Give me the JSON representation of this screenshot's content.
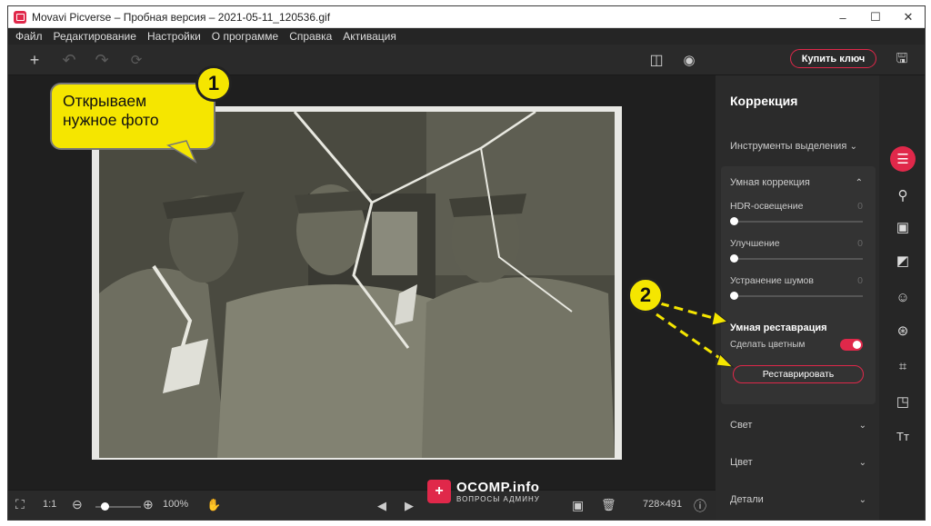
{
  "window": {
    "title": "Movavi Picverse – Пробная версия – 2021-05-11_120536.gif",
    "minimize": "–",
    "maximize": "☐",
    "close": "✕"
  },
  "menu": [
    "Файл",
    "Редактирование",
    "Настройки",
    "О программе",
    "Справка",
    "Активация"
  ],
  "toolbar": {
    "add": "+",
    "undo": "↶",
    "redo": "↷",
    "reset": "⟳",
    "compare": "◫",
    "preview": "◉",
    "buy_label": "Купить ключ",
    "save": "🖫"
  },
  "sidebar": {
    "title": "Коррекция",
    "selection_tools": "Инструменты выделения",
    "smart_correction": {
      "title": "Умная коррекция",
      "sliders": [
        {
          "label": "HDR-освещение",
          "value": "0",
          "level": 0
        },
        {
          "label": "Улучшение",
          "value": "0",
          "level": 0
        },
        {
          "label": "Устранение шумов",
          "value": "0",
          "level": 0
        }
      ]
    },
    "smart_restoration": {
      "title": "Умная реставрация",
      "colorize_label": "Сделать цветным",
      "colorize_on": true,
      "restore_label": "Реставрировать"
    },
    "sections": [
      "Свет",
      "Цвет",
      "Детали"
    ],
    "chevron_down": "⌄",
    "chevron_up": "⌃"
  },
  "rightbar_icons": [
    "adjust-icon",
    "stamp-icon",
    "image-icon",
    "frame-icon",
    "face-icon",
    "filters-icon",
    "crop-icon",
    "select-icon",
    "text-icon"
  ],
  "rightbar_glyphs": [
    "☰",
    "⚲",
    "▣",
    "◩",
    "☺",
    "⊛",
    "⌗",
    "◳",
    "Tт"
  ],
  "bottombar": {
    "fullscreen": "⛶",
    "one_to_one": "1:1",
    "zoom_out": "⊖",
    "zoom_in": "⊕",
    "zoom_value": "100%",
    "zoom_level": 0.2,
    "hand": "✋",
    "prev": "◀",
    "next": "▶",
    "image": "▣",
    "delete": "🗑",
    "dimensions": "728×491",
    "info": "ⓘ"
  },
  "annotations": {
    "callout_1": "Открываем нужное фото",
    "badge_1": "1",
    "badge_2": "2"
  },
  "watermark": {
    "logo": "+",
    "main": "OCOMP.info",
    "sub": "ВОПРОСЫ АДМИНУ"
  },
  "colors": {
    "accent": "#e0284a",
    "callout": "#f5e600"
  }
}
